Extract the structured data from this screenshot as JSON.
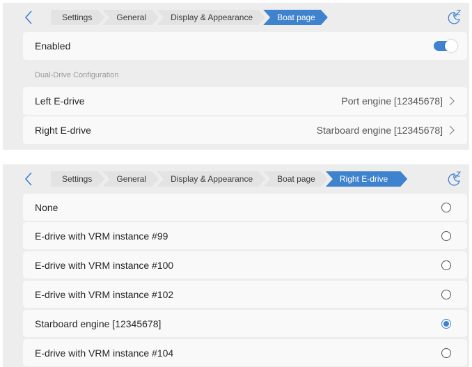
{
  "colors": {
    "accent": "#3f82ce",
    "panel_bg": "#ededed",
    "row_bg": "#f9f9f9",
    "crumb_bg": "#e3e3e3"
  },
  "screen1": {
    "breadcrumbs": [
      "Settings",
      "General",
      "Display & Appearance",
      "Boat page"
    ],
    "active_crumb": "Boat page",
    "enabled": {
      "label": "Enabled",
      "on": true
    },
    "section": "Dual-Drive Configuration",
    "left": {
      "label": "Left E-drive",
      "value": "Port engine [12345678]"
    },
    "right": {
      "label": "Right E-drive",
      "value": "Starboard engine [12345678]"
    }
  },
  "screen2": {
    "breadcrumbs": [
      "Settings",
      "General",
      "Display & Appearance",
      "Boat page",
      "Right E-drive"
    ],
    "active_crumb": "Right E-drive",
    "options": [
      {
        "label": "None",
        "selected": false
      },
      {
        "label": "E-drive with VRM instance #99",
        "selected": false
      },
      {
        "label": "E-drive with VRM instance #100",
        "selected": false
      },
      {
        "label": "E-drive with VRM instance #102",
        "selected": false
      },
      {
        "label": "Starboard engine [12345678]",
        "selected": true
      },
      {
        "label": "E-drive with VRM instance #104",
        "selected": false
      }
    ]
  },
  "icons": {
    "back": "chevron-left-icon",
    "theme": "moon-zz-icon",
    "row_arrow": "chevron-right-icon"
  }
}
